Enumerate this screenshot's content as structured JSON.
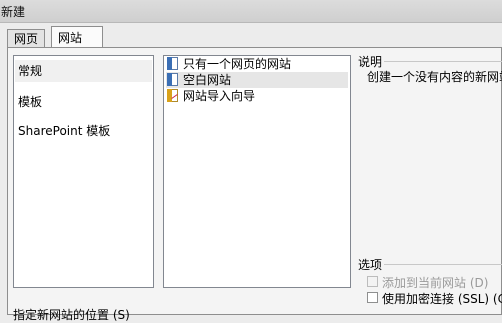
{
  "window": {
    "title": "新建"
  },
  "tabs": [
    {
      "label": "网页",
      "active": false
    },
    {
      "label": "网站",
      "active": true
    }
  ],
  "categories": {
    "items": [
      {
        "label": "常规",
        "selected": true
      },
      {
        "label": "模板",
        "selected": false
      },
      {
        "label": "SharePoint 模板",
        "selected": false
      }
    ]
  },
  "templates": {
    "items": [
      {
        "label": "只有一个网页的网站",
        "icon": "page-icon",
        "selected": false
      },
      {
        "label": "空白网站",
        "icon": "page-icon",
        "selected": true
      },
      {
        "label": "网站导入向导",
        "icon": "wizard-icon",
        "selected": false
      }
    ]
  },
  "description": {
    "label": "说明",
    "text": "创建一个没有内容的新网站。"
  },
  "options": {
    "label": "选项",
    "add_to_current": {
      "label": "添加到当前网站 (D)",
      "checked": false,
      "enabled": false
    },
    "use_ssl": {
      "label": "使用加密连接 (SSL) (C)",
      "checked": false,
      "enabled": true
    }
  },
  "location": {
    "label": "指定新网站的位置 (S)"
  },
  "colors": {
    "selection": "#e6e6e6",
    "border": "#828790"
  }
}
